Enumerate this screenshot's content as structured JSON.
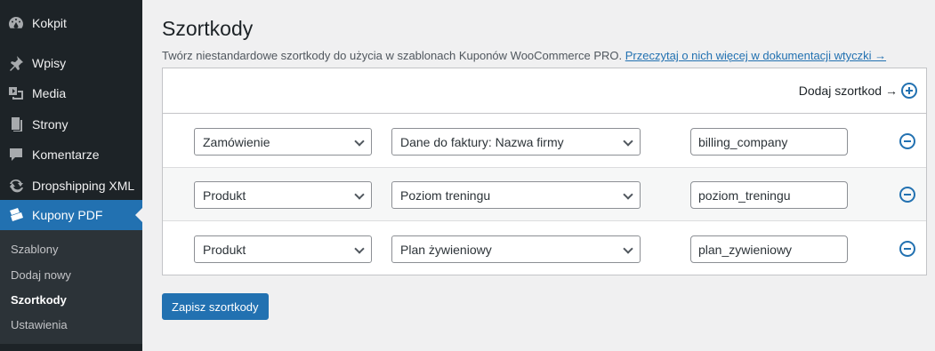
{
  "sidebar": {
    "items": [
      {
        "label": "Kokpit",
        "icon": "dashboard-icon"
      },
      {
        "label": "Wpisy",
        "icon": "pushpin-icon"
      },
      {
        "label": "Media",
        "icon": "media-icon"
      },
      {
        "label": "Strony",
        "icon": "pages-icon"
      },
      {
        "label": "Komentarze",
        "icon": "comment-icon"
      },
      {
        "label": "Dropshipping XML",
        "icon": "sync-icon"
      },
      {
        "label": "Kupony PDF",
        "icon": "tickets-icon"
      }
    ],
    "submenu": [
      "Szablony",
      "Dodaj nowy",
      "Szortkody",
      "Ustawienia"
    ],
    "active_color": "#2271b1"
  },
  "page": {
    "title": "Szortkody",
    "description": "Twórz niestandardowe szortkody do użycia w szablonach Kuponów WooCommerce PRO.",
    "doc_link": "Przeczytaj o nich więcej w dokumentacji wtyczki →",
    "add_label": "Dodaj szortkod →",
    "save_label": "Zapisz szortkody"
  },
  "rows": [
    {
      "source": "Zamówienie",
      "field": "Dane do faktury: Nazwa firmy",
      "code": "billing_company"
    },
    {
      "source": "Produkt",
      "field": "Poziom treningu",
      "code": "poziom_treningu"
    },
    {
      "source": "Produkt",
      "field": "Plan żywieniowy",
      "code": "plan_zywieniowy"
    }
  ]
}
